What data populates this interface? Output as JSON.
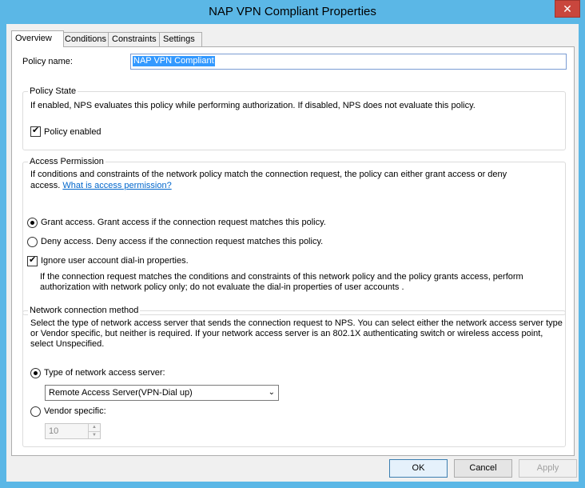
{
  "window": {
    "title": "NAP VPN Compliant Properties",
    "close_glyph": "✕"
  },
  "tabs": [
    {
      "label": "Overview",
      "active": true
    },
    {
      "label": "Conditions",
      "active": false
    },
    {
      "label": "Constraints",
      "active": false
    },
    {
      "label": "Settings",
      "active": false
    }
  ],
  "policy_name": {
    "label": "Policy name:",
    "value": "NAP VPN Compliant"
  },
  "policy_state": {
    "title": "Policy State",
    "description": "If enabled, NPS evaluates this policy while performing authorization. If disabled, NPS does not evaluate this policy.",
    "enabled_label": "Policy enabled",
    "enabled_checked": true
  },
  "access_permission": {
    "title": "Access Permission",
    "description_line1": "If conditions and constraints of the network policy match the connection request, the policy can either grant access or deny",
    "description_line2": "access.",
    "help_link": "What is access permission?",
    "grant_label": "Grant access. Grant access if the connection request matches this policy.",
    "grant_selected": true,
    "deny_label": "Deny access. Deny access if the connection request matches this policy.",
    "ignore_label": "Ignore user account dial-in properties.",
    "ignore_checked": true,
    "ignore_desc_line1": "If the connection request matches the conditions and constraints of this network policy and the policy grants access, perform",
    "ignore_desc_line2": "authorization with network policy only; do not evaluate the dial-in properties of user accounts ."
  },
  "network_method": {
    "title": "Network connection method",
    "description_line1": "Select the type of network access server that sends the connection request to NPS. You can select either the network access server type",
    "description_line2": "or Vendor specific, but neither is required.  If your network access server is an 802.1X authenticating switch or wireless access point,",
    "description_line3": "select Unspecified.",
    "type_label": "Type of network access server:",
    "type_selected": true,
    "type_value": "Remote Access Server(VPN-Dial up)",
    "vendor_label": "Vendor specific:",
    "vendor_value": "10"
  },
  "buttons": {
    "ok": "OK",
    "cancel": "Cancel",
    "apply": "Apply"
  }
}
